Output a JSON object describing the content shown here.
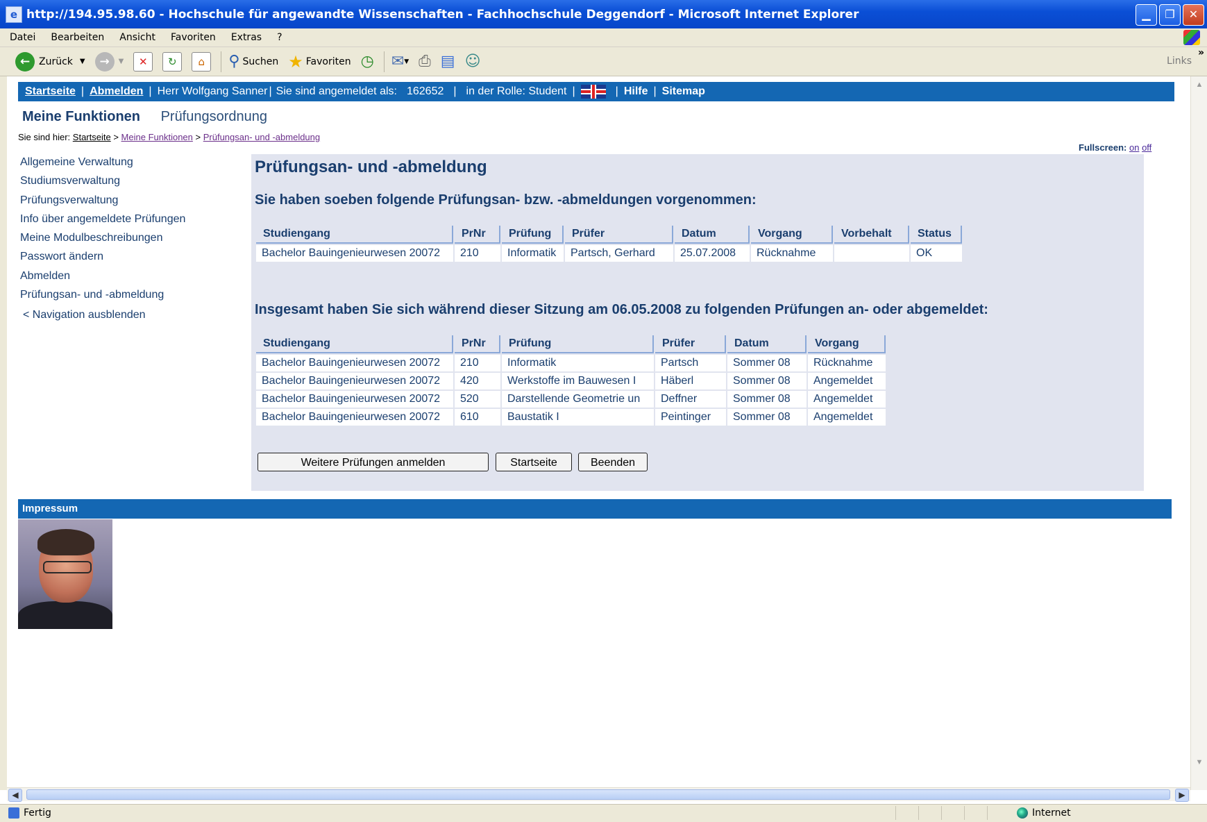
{
  "window": {
    "title": "http://194.95.98.60 - Hochschule für angewandte Wissenschaften - Fachhochschule Deggendorf - Microsoft Internet Explorer",
    "menu": [
      "Datei",
      "Bearbeiten",
      "Ansicht",
      "Favoriten",
      "Extras",
      "?"
    ],
    "toolbar": {
      "back": "Zurück",
      "search": "Suchen",
      "favorites": "Favoriten",
      "links": "Links",
      "more": "»"
    },
    "status": {
      "left": "Fertig",
      "zone": "Internet"
    }
  },
  "topnav": {
    "home": "Startseite",
    "logout": "Abmelden",
    "user": "Herr Wolfgang Sanner",
    "logged_in_label": "Sie sind angemeldet als:",
    "user_id": "162652",
    "role": "in der Rolle: Student",
    "help": "Hilfe",
    "sitemap": "Sitemap"
  },
  "tabs": {
    "active": "Meine Funktionen",
    "other": "Prüfungsordnung"
  },
  "breadcrumb": {
    "prefix": "Sie sind hier:",
    "items": [
      "Startseite",
      "Meine Funktionen",
      "Prüfungsan- und -abmeldung"
    ],
    "sep": ">"
  },
  "fullscreen": {
    "label": "Fullscreen:",
    "on": "on",
    "off": "off"
  },
  "sidenav": [
    "Allgemeine Verwaltung",
    "Studiumsverwaltung",
    "Prüfungsverwaltung",
    "Info über angemeldete Prüfungen",
    "Meine Modulbeschreibungen",
    "Passwort ändern",
    "Abmelden",
    "Prüfungsan- und -abmeldung"
  ],
  "hide_nav": "< Navigation ausblenden",
  "main": {
    "title": "Prüfungsan- und -abmeldung",
    "section1": "Sie haben soeben folgende Prüfungsan- bzw. -abmeldungen vorgenommen:",
    "table1": {
      "headers": [
        "Studiengang",
        "PrNr",
        "Prüfung",
        "Prüfer",
        "Datum",
        "Vorgang",
        "Vorbehalt",
        "Status"
      ],
      "rows": [
        [
          "Bachelor Bauingenieurwesen 20072",
          "210",
          "Informatik",
          "Partsch, Gerhard",
          "25.07.2008",
          "Rücknahme",
          "",
          "OK"
        ]
      ]
    },
    "section2": "Insgesamt haben Sie sich während dieser Sitzung am 06.05.2008 zu folgenden Prüfungen an- oder abgemeldet:",
    "table2": {
      "headers": [
        "Studiengang",
        "PrNr",
        "Prüfung",
        "Prüfer",
        "Datum",
        "Vorgang"
      ],
      "rows": [
        [
          "Bachelor Bauingenieurwesen 20072",
          "210",
          "Informatik",
          "Partsch",
          "Sommer 08",
          "Rücknahme"
        ],
        [
          "Bachelor Bauingenieurwesen 20072",
          "420",
          "Werkstoffe im Bauwesen I",
          "Häberl",
          "Sommer 08",
          "Angemeldet"
        ],
        [
          "Bachelor Bauingenieurwesen 20072",
          "520",
          "Darstellende Geometrie un",
          "Deffner",
          "Sommer 08",
          "Angemeldet"
        ],
        [
          "Bachelor Bauingenieurwesen 20072",
          "610",
          "Baustatik I",
          "Peintinger",
          "Sommer 08",
          "Angemeldet"
        ]
      ]
    },
    "buttons": {
      "more": "Weitere Prüfungen anmelden",
      "home": "Startseite",
      "quit": "Beenden"
    }
  },
  "footer": {
    "impressum": "Impressum"
  },
  "colors": {
    "nav_blue": "#1467b3",
    "content_bg": "#e1e4ef",
    "heading": "#1a3e6e"
  }
}
